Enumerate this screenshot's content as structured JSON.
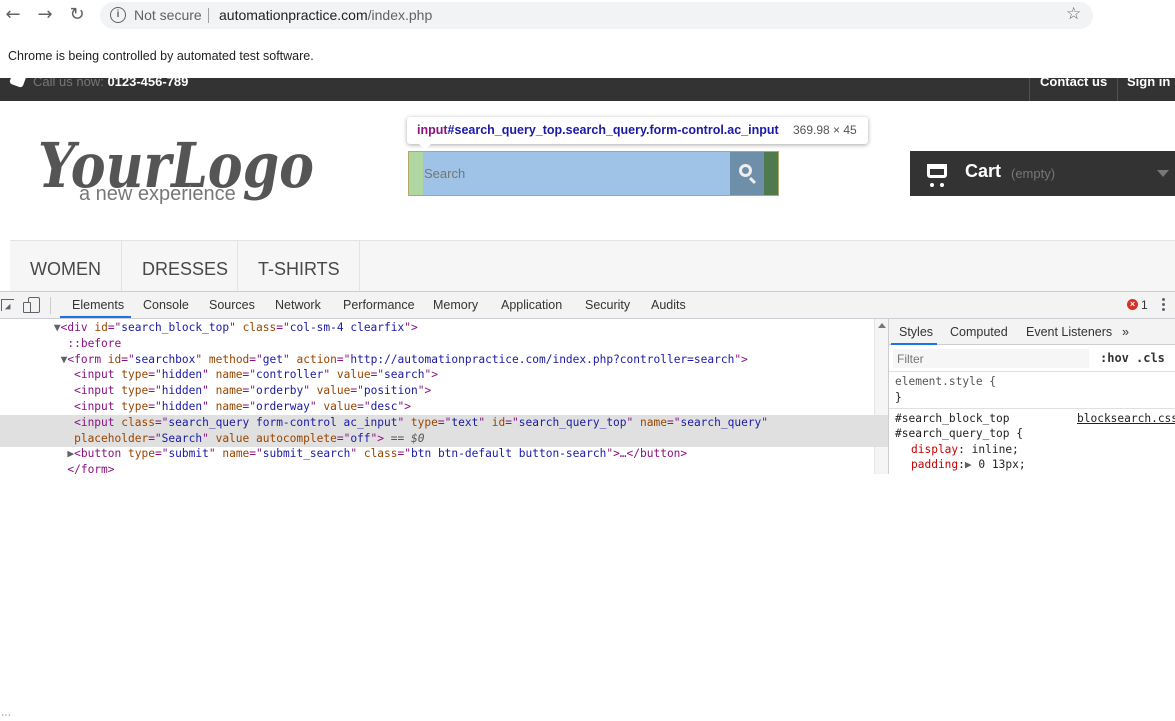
{
  "browser": {
    "back_icon": "arrow-left-icon",
    "forward_icon": "arrow-right-icon",
    "reload_icon": "reload-icon",
    "security_label": "Not secure",
    "url_host": "automationpractice.com",
    "url_path": "/index.php",
    "bookmark_icon": "star-icon",
    "infobar_text": "Chrome is being controlled by automated test software."
  },
  "site": {
    "topbar": {
      "call_label": "Call us now:",
      "phone": "0123-456-789",
      "contact_label": "Contact us",
      "signin_label": "Sign in"
    },
    "logo": {
      "main": "YourLogo",
      "tagline": "a new experience"
    },
    "search": {
      "placeholder": "Search"
    },
    "inspect_tooltip": {
      "element": "input",
      "selector": "#search_query_top.search_query.form-control.ac_input",
      "dimensions": "369.98 × 45"
    },
    "cart": {
      "label": "Cart",
      "status": "(empty)"
    },
    "menu": [
      "WOMEN",
      "DRESSES",
      "T-SHIRTS"
    ]
  },
  "devtools": {
    "tabs": [
      "Elements",
      "Console",
      "Sources",
      "Network",
      "Performance",
      "Memory",
      "Application",
      "Security",
      "Audits"
    ],
    "active_tab": "Elements",
    "error_count": "1",
    "dom_lines": [
      {
        "indent": "        ",
        "tri": "▼",
        "parts": [
          [
            "tg",
            "<div "
          ],
          [
            "an",
            "id"
          ],
          [
            "tg",
            "=\""
          ],
          [
            "av",
            "search_block_top"
          ],
          [
            "tg",
            "\" "
          ],
          [
            "an",
            "class"
          ],
          [
            "tg",
            "=\""
          ],
          [
            "av",
            "col-sm-4 clearfix"
          ],
          [
            "tg",
            "\">"
          ]
        ]
      },
      {
        "indent": "          ",
        "tri": "",
        "parts": [
          [
            "ps",
            "::before"
          ]
        ]
      },
      {
        "indent": "        ",
        "tri": " ▼",
        "parts": [
          [
            "tg",
            "<form "
          ],
          [
            "an",
            "id"
          ],
          [
            "tg",
            "=\""
          ],
          [
            "av",
            "searchbox"
          ],
          [
            "tg",
            "\" "
          ],
          [
            "an",
            "method"
          ],
          [
            "tg",
            "=\""
          ],
          [
            "av",
            "get"
          ],
          [
            "tg",
            "\" "
          ],
          [
            "an",
            "action"
          ],
          [
            "tg",
            "=\""
          ],
          [
            "av",
            "http://automationpractice.com/index.php?controller=search"
          ],
          [
            "tg",
            "\">"
          ]
        ]
      },
      {
        "indent": "           ",
        "tri": "",
        "parts": [
          [
            "tg",
            "<input "
          ],
          [
            "an",
            "type"
          ],
          [
            "tg",
            "=\""
          ],
          [
            "av",
            "hidden"
          ],
          [
            "tg",
            "\" "
          ],
          [
            "an",
            "name"
          ],
          [
            "tg",
            "=\""
          ],
          [
            "av",
            "controller"
          ],
          [
            "tg",
            "\" "
          ],
          [
            "an",
            "value"
          ],
          [
            "tg",
            "=\""
          ],
          [
            "av",
            "search"
          ],
          [
            "tg",
            "\">"
          ]
        ]
      },
      {
        "indent": "           ",
        "tri": "",
        "parts": [
          [
            "tg",
            "<input "
          ],
          [
            "an",
            "type"
          ],
          [
            "tg",
            "=\""
          ],
          [
            "av",
            "hidden"
          ],
          [
            "tg",
            "\" "
          ],
          [
            "an",
            "name"
          ],
          [
            "tg",
            "=\""
          ],
          [
            "av",
            "orderby"
          ],
          [
            "tg",
            "\" "
          ],
          [
            "an",
            "value"
          ],
          [
            "tg",
            "=\""
          ],
          [
            "av",
            "position"
          ],
          [
            "tg",
            "\">"
          ]
        ]
      },
      {
        "indent": "           ",
        "tri": "",
        "parts": [
          [
            "tg",
            "<input "
          ],
          [
            "an",
            "type"
          ],
          [
            "tg",
            "=\""
          ],
          [
            "av",
            "hidden"
          ],
          [
            "tg",
            "\" "
          ],
          [
            "an",
            "name"
          ],
          [
            "tg",
            "=\""
          ],
          [
            "av",
            "orderway"
          ],
          [
            "tg",
            "\" "
          ],
          [
            "an",
            "value"
          ],
          [
            "tg",
            "=\""
          ],
          [
            "av",
            "desc"
          ],
          [
            "tg",
            "\">"
          ]
        ]
      },
      {
        "indent": "           ",
        "tri": "",
        "sel": true,
        "parts": [
          [
            "tg",
            "<input "
          ],
          [
            "an",
            "class"
          ],
          [
            "tg",
            "=\""
          ],
          [
            "av",
            "search_query form-control ac_input"
          ],
          [
            "tg",
            "\" "
          ],
          [
            "an",
            "type"
          ],
          [
            "tg",
            "=\""
          ],
          [
            "av",
            "text"
          ],
          [
            "tg",
            "\" "
          ],
          [
            "an",
            "id"
          ],
          [
            "tg",
            "=\""
          ],
          [
            "av",
            "search_query_top"
          ],
          [
            "tg",
            "\" "
          ],
          [
            "an",
            "name"
          ],
          [
            "tg",
            "=\""
          ],
          [
            "av",
            "search_query"
          ],
          [
            "tg",
            "\""
          ]
        ]
      },
      {
        "indent": "           ",
        "tri": "",
        "sel": true,
        "parts": [
          [
            "an",
            "placeholder"
          ],
          [
            "tg",
            "=\""
          ],
          [
            "av",
            "Search"
          ],
          [
            "tg",
            "\" "
          ],
          [
            "an",
            "value autocomplete"
          ],
          [
            "tg",
            "=\""
          ],
          [
            "av",
            "off"
          ],
          [
            "tg",
            "\">"
          ],
          [
            "ds",
            " == $0"
          ]
        ]
      },
      {
        "indent": "          ",
        "tri": "▶",
        "parts": [
          [
            "tg",
            "<button "
          ],
          [
            "an",
            "type"
          ],
          [
            "tg",
            "=\""
          ],
          [
            "av",
            "submit"
          ],
          [
            "tg",
            "\" "
          ],
          [
            "an",
            "name"
          ],
          [
            "tg",
            "=\""
          ],
          [
            "av",
            "submit_search"
          ],
          [
            "tg",
            "\" "
          ],
          [
            "an",
            "class"
          ],
          [
            "tg",
            "=\""
          ],
          [
            "av",
            "btn btn-default button-search"
          ],
          [
            "tg",
            "\">…</button>"
          ]
        ]
      },
      {
        "indent": "          ",
        "tri": "",
        "parts": [
          [
            "tg",
            "</form>"
          ]
        ]
      }
    ],
    "styles": {
      "tabs": [
        "Styles",
        "Computed",
        "Event Listeners"
      ],
      "more": "»",
      "filter_placeholder": "Filter",
      "hov": ":hov",
      "cls": ".cls",
      "element_style_open": "element.style {",
      "element_style_close": "}",
      "rule_selector_1": "#search_block_top",
      "rule_selector_2": "#search_query_top {",
      "rule_source": "blocksearch.css",
      "prop1_name": "display",
      "prop1_value": "inline;",
      "prop2_name": "padding",
      "prop2_value": "0 13px;"
    }
  }
}
